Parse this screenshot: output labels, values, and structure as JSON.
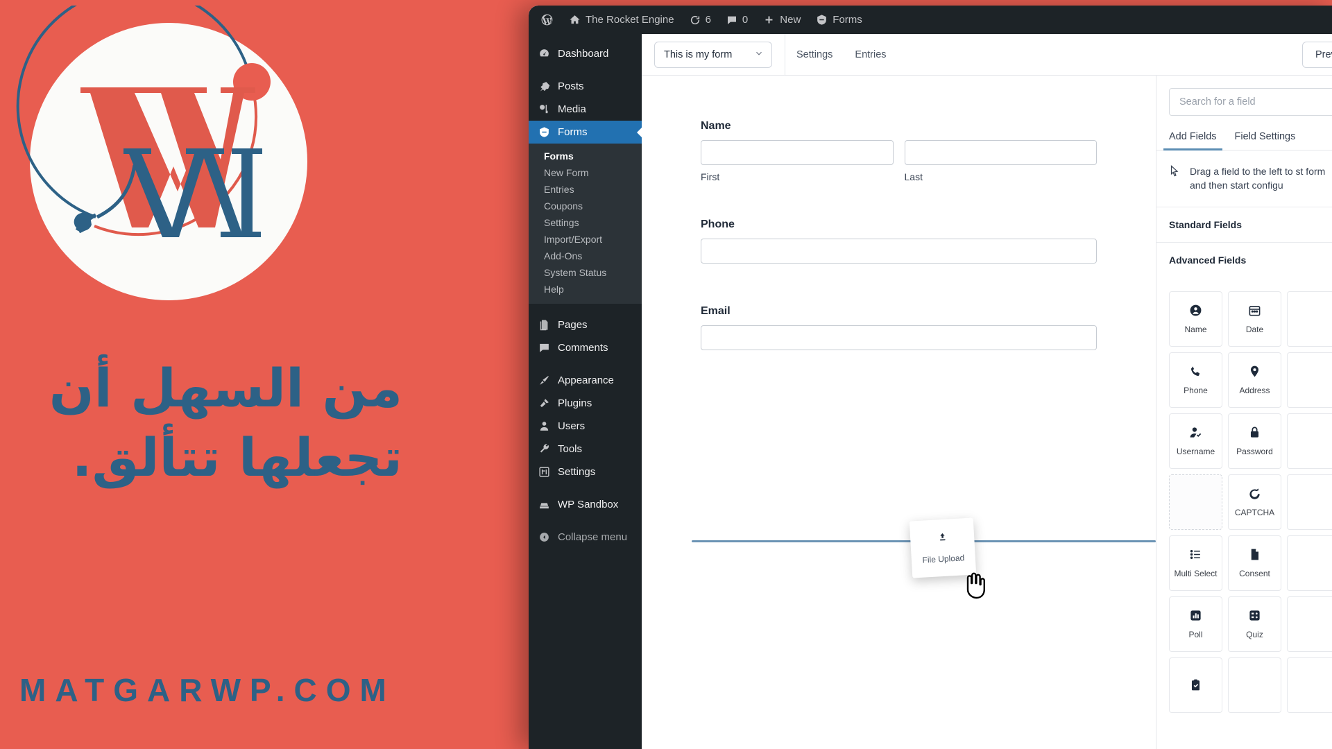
{
  "promo": {
    "arabic_headline": "من السهل أن تجعلها تتألق.",
    "domain": "MATGARWP.COM",
    "logo_name": "wm-plug-logo",
    "bg_color": "#e85d50",
    "accent_color": "#2d6186"
  },
  "adminbar": {
    "wp_logo": "wordpress-logo-icon",
    "site_name": "The Rocket Engine",
    "updates_count": "6",
    "comments_count": "0",
    "new_label": "New",
    "forms_label": "Forms"
  },
  "adminmenu": {
    "items": [
      {
        "label": "Dashboard",
        "icon": "dashboard-icon",
        "state": "normal",
        "gap": false
      },
      {
        "label": "Posts",
        "icon": "pin-icon",
        "state": "normal",
        "gap": true
      },
      {
        "label": "Media",
        "icon": "media-icon",
        "state": "normal",
        "gap": false
      },
      {
        "label": "Forms",
        "icon": "forms-icon",
        "state": "current",
        "gap": false
      }
    ],
    "submenu": [
      {
        "label": "Forms",
        "current": true
      },
      {
        "label": "New Form",
        "current": false
      },
      {
        "label": "Entries",
        "current": false
      },
      {
        "label": "Coupons",
        "current": false
      },
      {
        "label": "Settings",
        "current": false
      },
      {
        "label": "Import/Export",
        "current": false
      },
      {
        "label": "Add-Ons",
        "current": false
      },
      {
        "label": "System Status",
        "current": false
      },
      {
        "label": "Help",
        "current": false
      }
    ],
    "items_lower": [
      {
        "label": "Pages",
        "icon": "pages-icon",
        "gap": true
      },
      {
        "label": "Comments",
        "icon": "comments-icon",
        "gap": false
      },
      {
        "label": "Appearance",
        "icon": "appearance-brush-icon",
        "gap": true
      },
      {
        "label": "Plugins",
        "icon": "plugins-icon",
        "gap": false
      },
      {
        "label": "Users",
        "icon": "users-icon",
        "gap": false
      },
      {
        "label": "Tools",
        "icon": "tools-wrench-icon",
        "gap": false
      },
      {
        "label": "Settings",
        "icon": "settings-sliders-icon",
        "gap": false
      },
      {
        "label": "WP Sandbox",
        "icon": "sandbox-icon",
        "gap": true
      }
    ],
    "collapse_label": "Collapse menu"
  },
  "toolbar": {
    "form_name": "This is my form",
    "settings_label": "Settings",
    "entries_label": "Entries",
    "preview_label": "Previ"
  },
  "canvas": {
    "fields": [
      {
        "label": "Name",
        "type": "name",
        "sub": [
          {
            "label": "First"
          },
          {
            "label": "Last"
          }
        ]
      },
      {
        "label": "Phone",
        "type": "text",
        "sub": []
      },
      {
        "label": "Email",
        "type": "text",
        "sub": []
      }
    ],
    "drag_ghost": {
      "label": "File Upload",
      "icon": "upload-icon"
    },
    "cursor": "grab-hand-cursor",
    "drop_indicator_color": "#6b93b4"
  },
  "fieldpanel": {
    "search_placeholder": "Search for a field",
    "tabs": [
      {
        "label": "Add Fields",
        "active": true
      },
      {
        "label": "Field Settings",
        "active": false
      }
    ],
    "hint": "Drag a field to the left to st form and then start configu",
    "hint_icon": "mouse-pointer-icon",
    "sections": [
      {
        "label": "Standard Fields"
      },
      {
        "label": "Advanced Fields"
      }
    ],
    "tiles": [
      {
        "label": "Name",
        "icon": "person-circle-icon",
        "empty": false
      },
      {
        "label": "Date",
        "icon": "calendar-icon",
        "empty": false
      },
      {
        "label": "",
        "icon": "",
        "empty": false,
        "cut": true
      },
      {
        "label": "Phone",
        "icon": "phone-icon",
        "empty": false
      },
      {
        "label": "Address",
        "icon": "map-pin-icon",
        "empty": false
      },
      {
        "label": "",
        "icon": "",
        "empty": false,
        "cut": true
      },
      {
        "label": "Username",
        "icon": "user-check-icon",
        "empty": false
      },
      {
        "label": "Password",
        "icon": "lock-icon",
        "empty": false
      },
      {
        "label": "",
        "icon": "",
        "empty": false,
        "cut": true
      },
      {
        "label": "",
        "icon": "",
        "empty": true
      },
      {
        "label": "CAPTCHA",
        "icon": "captcha-icon",
        "empty": false
      },
      {
        "label": "",
        "icon": "",
        "empty": false,
        "cut": true
      },
      {
        "label": "Multi Select",
        "icon": "list-icon",
        "empty": false
      },
      {
        "label": "Consent",
        "icon": "document-icon",
        "empty": false
      },
      {
        "label": "",
        "icon": "",
        "empty": false,
        "cut": true
      },
      {
        "label": "Poll",
        "icon": "chart-bar-icon",
        "empty": false
      },
      {
        "label": "Quiz",
        "icon": "quiz-grid-icon",
        "empty": false
      },
      {
        "label": "",
        "icon": "",
        "empty": false,
        "cut": true
      },
      {
        "label": "",
        "icon": "clipboard-check-icon",
        "empty": false
      },
      {
        "label": "",
        "icon": "",
        "empty": false,
        "cut": true
      },
      {
        "label": "",
        "icon": "",
        "empty": false,
        "cut": true
      }
    ]
  }
}
